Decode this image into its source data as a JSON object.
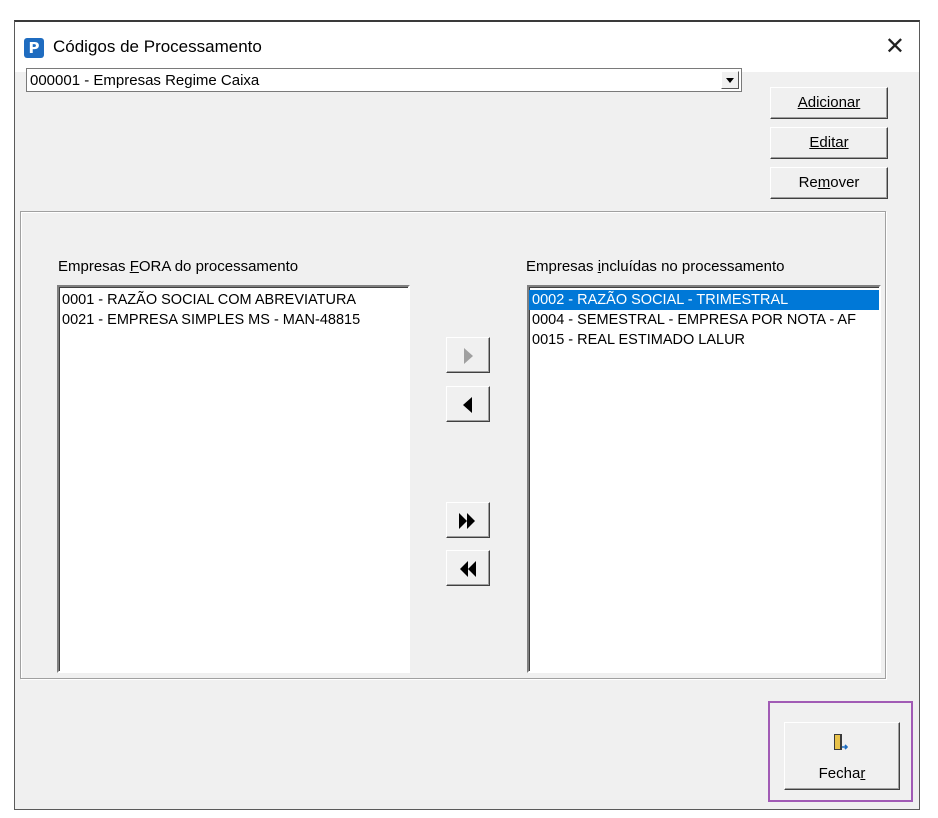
{
  "window": {
    "title": "Códigos de Processamento",
    "close_glyph": "✕"
  },
  "app_icon": {
    "name": "p-logo-icon",
    "letter": "P",
    "color": "#1f6cc0"
  },
  "combo": {
    "value": "000001 - Empresas Regime Caixa"
  },
  "side_buttons": {
    "adicionar": {
      "before": "",
      "ul": "A",
      "after": "dicionar"
    },
    "editar": {
      "before": "",
      "ul": "E",
      "after": "ditar"
    },
    "remover": {
      "before": "Re",
      "ul": "m",
      "after": "over"
    }
  },
  "left": {
    "label_before": "Empresas ",
    "label_ul": "F",
    "label_after": "ORA do processamento",
    "items": [
      "0001 - RAZÃO SOCIAL COM ABREVIATURA",
      "0021 - EMPRESA SIMPLES MS - MAN-48815"
    ]
  },
  "right": {
    "label_before": "Empresas ",
    "label_ul": "i",
    "label_after": "ncluídas no processamento",
    "items": [
      "0002 - RAZÃO SOCIAL - TRIMESTRAL",
      "0004 - SEMESTRAL - EMPRESA POR NOTA - AF",
      "0015 - REAL ESTIMADO LALUR"
    ],
    "selected_index": 0
  },
  "transfer_buttons": [
    {
      "name": "move-right-button",
      "icon": "arrow-right-icon",
      "enabled": false
    },
    {
      "name": "move-left-button",
      "icon": "arrow-left-icon",
      "enabled": true
    },
    {
      "name": "move-all-right-button",
      "icon": "double-arrow-right-icon",
      "enabled": true
    },
    {
      "name": "move-all-left-button",
      "icon": "double-arrow-left-icon",
      "enabled": true
    }
  ],
  "fechar": {
    "label_before": "Fecha",
    "label_ul": "r",
    "icon": "door-exit-icon"
  },
  "colors": {
    "selection": "#0078d7",
    "highlight_box": "#a15bb5",
    "face": "#f0f0f0"
  }
}
